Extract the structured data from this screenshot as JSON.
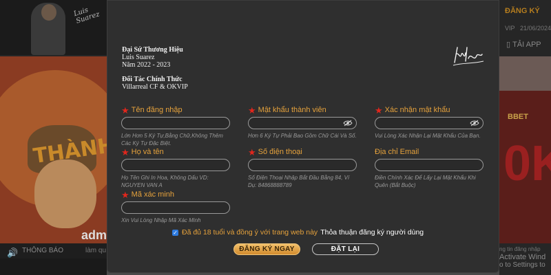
{
  "background": {
    "left_title": "THÀNH",
    "left_brand": "adm",
    "news_label": "THÔNG BÁO",
    "news_more": "làm qu",
    "right_register": "ĐĂNG KÝ",
    "right_vip": "VIP",
    "right_date": "21/06/2024",
    "right_app": "TẢI APP",
    "right_banner_text": "BBET",
    "right_banner_big": "0K",
    "chat_text": "ng tin đăng nhập",
    "activate_windows": "Activate Wind",
    "activate_settings": "o to Settings to"
  },
  "modal": {
    "ambassador": {
      "heading": "Đại Sứ Thương Hiệu",
      "name": "Luis Suarez",
      "years": "Năm 2022 - 2023",
      "partner_heading": "Đối Tác Chính Thức",
      "partner": "Villarreal CF & OKVIP"
    },
    "fields": {
      "username": {
        "label": "Tên đăng nhập",
        "value": "",
        "hint": "Lớn Hơn 5 Ký Tự,Bằng Chữ,Không Thêm Các Ký Tự Đặc Biệt."
      },
      "password": {
        "label": "Mật khẩu thành viên",
        "value": "",
        "hint": "Hơn 6 Ký Tự Phải Bao Gồm Chữ Cái Và Số."
      },
      "confirm": {
        "label": "Xác nhận mật khẩu",
        "value": "",
        "hint": "Vui Lòng Xác Nhận Lại Mật Khẩu Của Bạn."
      },
      "fullname": {
        "label": "Họ và tên",
        "value": "",
        "hint": "Họ Tên Ghi In Hoa, Không Dấu VD: NGUYEN VAN A"
      },
      "phone": {
        "label": "Số điện thoại",
        "value": "",
        "hint": "Số Điện Thoại Nhập Bắt Đầu Bằng 84, Ví Dụ: 84868888789"
      },
      "email": {
        "label": "Địa chỉ Email",
        "value": "",
        "hint": "Điền Chính Xác Để Lấy Lại Mật Khẩu Khi Quên (Bắt Buộc)"
      },
      "captcha": {
        "label": "Mã xác minh",
        "value": "",
        "hint": "Xin Vui Lòng Nhập Mã Xác Minh"
      }
    },
    "agreement": {
      "checked": true,
      "text": "Đã đủ 18 tuổi và đồng ý với trang web này",
      "link": "Thỏa thuận đăng ký người dùng"
    },
    "buttons": {
      "register": "ĐĂNG KÝ NGAY",
      "reset": "ĐẶT LẠI"
    }
  },
  "colors": {
    "accent_gold": "#e6a23c",
    "required_star": "#e1261c",
    "modal_bg": "#2f2f2f"
  }
}
